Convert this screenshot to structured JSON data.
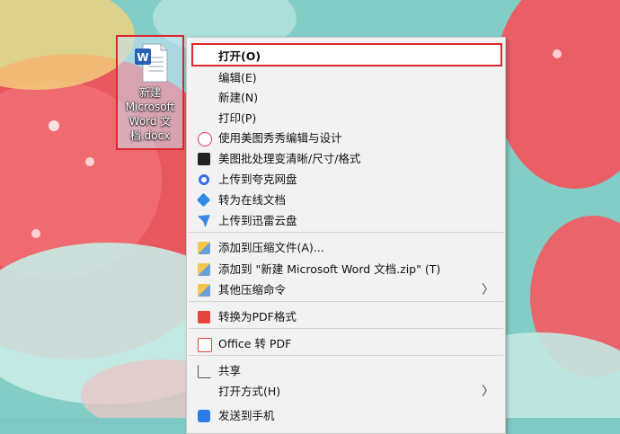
{
  "desktop": {
    "file_name": "新建 Microsoft Word 文档.docx"
  },
  "menu": {
    "items": [
      {
        "label": "打开(O)",
        "icon": "none"
      },
      {
        "label": "编辑(E)",
        "icon": "none"
      },
      {
        "label": "新建(N)",
        "icon": "none"
      },
      {
        "label": "打印(P)",
        "icon": "none"
      },
      {
        "label": "使用美图秀秀编辑与设计",
        "icon": "meitu-xiuxiu-icon"
      },
      {
        "label": "美图批处理变清晰/尺寸/格式",
        "icon": "meitu-batch-icon"
      },
      {
        "label": "上传到夸克网盘",
        "icon": "quark-cloud-icon"
      },
      {
        "label": "转为在线文档",
        "icon": "online-doc-icon"
      },
      {
        "label": "上传到迅雷云盘",
        "icon": "xunlei-cloud-icon"
      },
      {
        "label": "添加到压缩文件(A)...",
        "icon": "archive-icon"
      },
      {
        "label": "添加到 \"新建 Microsoft Word 文档.zip\" (T)",
        "icon": "archive-icon"
      },
      {
        "label": "其他压缩命令",
        "icon": "archive-icon"
      },
      {
        "label": "转换为PDF格式",
        "icon": "pdf-convert-icon"
      },
      {
        "label": "Office 转 PDF",
        "icon": "office-pdf-icon"
      },
      {
        "label": "共享",
        "icon": "share-icon"
      },
      {
        "label": "打开方式(H)",
        "icon": "none"
      },
      {
        "label": "发送到手机",
        "icon": "phone-icon"
      }
    ],
    "submenu_arrow": "〉"
  },
  "colors": {
    "highlight_border": "#e0252e",
    "menu_bg": "#f2f2f2"
  }
}
